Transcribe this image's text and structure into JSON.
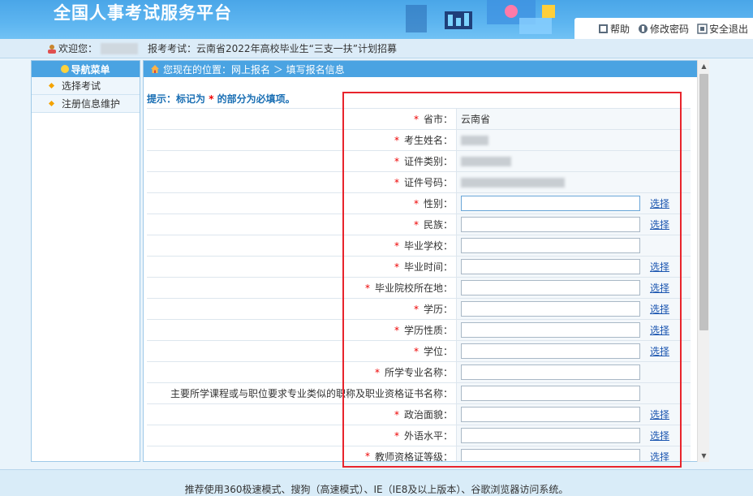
{
  "header": {
    "title": "全国人事考试服务平台",
    "links": [
      {
        "label": "帮助",
        "icon": "help-icon"
      },
      {
        "label": "修改密码",
        "icon": "edit-password-icon"
      },
      {
        "label": "安全退出",
        "icon": "logout-icon"
      }
    ]
  },
  "welcome": {
    "greeting": "欢迎您：",
    "exam_prefix": "报考考试：",
    "exam_name": "云南省2022年高校毕业生“三支一扶”计划招募"
  },
  "sidebar": {
    "title": "导航菜单",
    "items": [
      {
        "label": "选择考试"
      },
      {
        "label": "注册信息维护"
      }
    ]
  },
  "breadcrumb": {
    "text": "您现在的位置：网上报名 ＞ 填写报名信息"
  },
  "tip": {
    "prefix": "提示：标记为",
    "star": "*",
    "suffix": "的部分为必填项。"
  },
  "form": {
    "choose_label": "选择",
    "province_value": "云南省",
    "rows": [
      {
        "label": "省市：",
        "required": true
      },
      {
        "label": "考生姓名：",
        "required": true
      },
      {
        "label": "证件类别：",
        "required": true
      },
      {
        "label": "证件号码：",
        "required": true
      },
      {
        "label": "性别：",
        "required": true
      },
      {
        "label": "民族：",
        "required": true
      },
      {
        "label": "毕业学校：",
        "required": true
      },
      {
        "label": "毕业时间：",
        "required": true
      },
      {
        "label": "毕业院校所在地：",
        "required": true
      },
      {
        "label": "学历：",
        "required": true
      },
      {
        "label": "学历性质：",
        "required": true
      },
      {
        "label": "学位：",
        "required": true
      },
      {
        "label": "所学专业名称：",
        "required": true
      },
      {
        "label": "主要所学课程或与职位要求专业类似的职称及职业资格证书名称：",
        "required": false
      },
      {
        "label": "政治面貌：",
        "required": true
      },
      {
        "label": "外语水平：",
        "required": true
      },
      {
        "label": "教师资格证等级：",
        "required": true
      }
    ]
  },
  "footer": {
    "text": "推荐使用360极速模式、搜狗（高速模式）、IE（IE8及以上版本）、谷歌浏览器访问系统。"
  },
  "colors": {
    "header_blue": "#4aa6e8",
    "nav_blue": "#4aa3e2",
    "required_red": "#e00000",
    "highlight_red": "#e8242c",
    "link_blue": "#1a55b0"
  }
}
